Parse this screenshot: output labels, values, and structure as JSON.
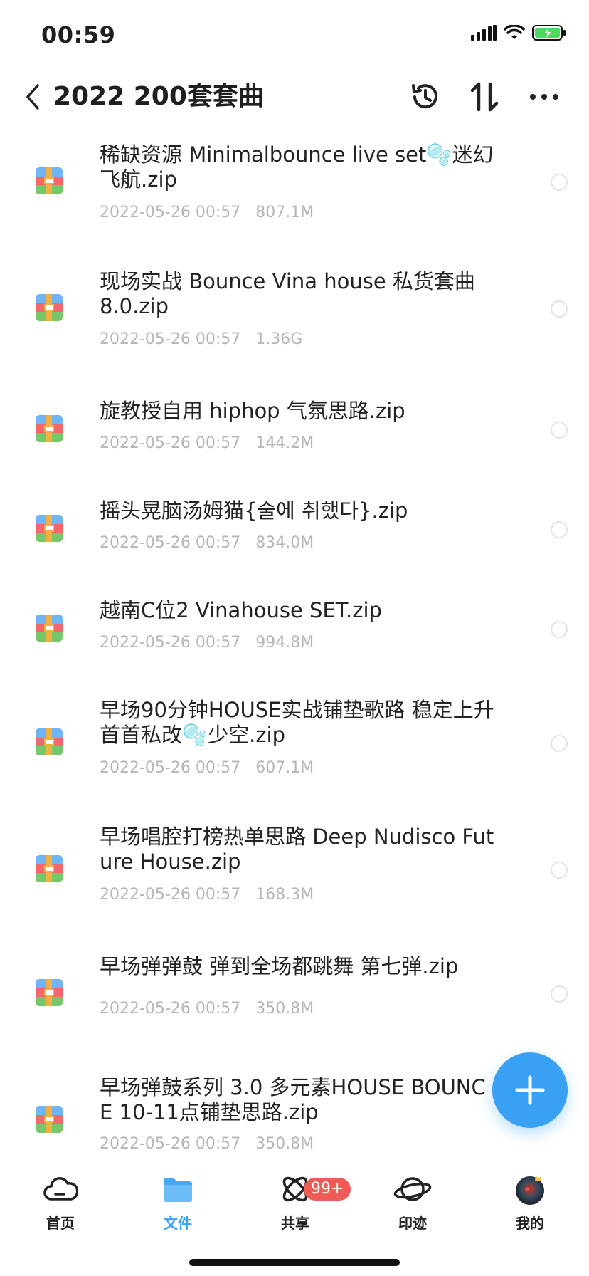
{
  "status_bar": {
    "time": "00:59"
  },
  "header": {
    "title": "2022 200套套曲"
  },
  "files": [
    {
      "name": "稀缺资源 Minimalbounce live set🫧迷幻飞航.zip",
      "date": "2022-05-26 00:57",
      "size": "807.1M"
    },
    {
      "name": "现场实战 Bounce Vina house 私货套曲 8.0.zip",
      "date": "2022-05-26 00:57",
      "size": "1.36G"
    },
    {
      "name": "旋教授自用 hiphop 气氛思路.zip",
      "date": "2022-05-26 00:57",
      "size": "144.2M"
    },
    {
      "name": "摇头晃脑汤姆猫{술에 취했다}.zip",
      "date": "2022-05-26 00:57",
      "size": "834.0M"
    },
    {
      "name": "越南C位2 Vinahouse SET.zip",
      "date": "2022-05-26 00:57",
      "size": "994.8M"
    },
    {
      "name": "早场90分钟HOUSE实战铺垫歌路 稳定上升 首首私改🫧少空.zip",
      "date": "2022-05-26 00:57",
      "size": "607.1M"
    },
    {
      "name": "早场唱腔打榜热单思路 Deep Nudisco Future House.zip",
      "date": "2022-05-26 00:57",
      "size": "168.3M"
    },
    {
      "name": "早场弹弹鼓 弹到全场都跳舞 第七弹.zip",
      "date": "2022-05-26 00:57",
      "size": "350.8M"
    },
    {
      "name": "早场弹鼓系列 3.0 多元素HOUSE BOUNCE 10-11点铺垫思路.zip",
      "date": "2022-05-26 00:57",
      "size": "350.8M"
    }
  ],
  "tabs": [
    {
      "label": "首页",
      "icon": "cloud-icon"
    },
    {
      "label": "文件",
      "icon": "folder-icon"
    },
    {
      "label": "共享",
      "icon": "orbit-icon",
      "badge": "99+"
    },
    {
      "label": "印迹",
      "icon": "planet-icon"
    },
    {
      "label": "我的",
      "icon": "avatar"
    }
  ],
  "colors": {
    "accent": "#3aa0f3",
    "badge": "#ef5b56",
    "meta": "#b6b6b6"
  }
}
